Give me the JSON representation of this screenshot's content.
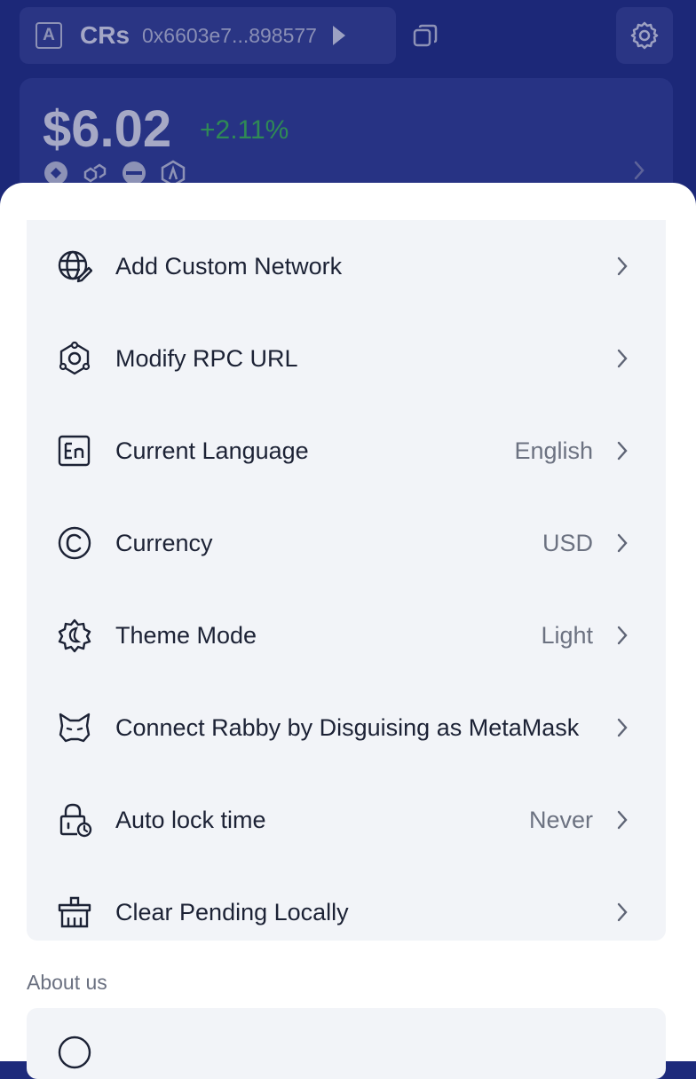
{
  "header": {
    "account_badge": "A",
    "account_name": "CRs",
    "account_address": "0x6603e7...898577",
    "balance": "$6.02",
    "balance_change": "+2.11%",
    "change_color": "#2f8a55",
    "chain_icons": [
      "chain-icon-1",
      "chain-icon-2",
      "chain-icon-3",
      "chain-icon-4"
    ]
  },
  "settings": {
    "items": [
      {
        "label": "Add Custom Network",
        "value": "",
        "icon": "globe-edit-icon"
      },
      {
        "label": "Modify RPC URL",
        "value": "",
        "icon": "rpc-node-icon"
      },
      {
        "label": "Current Language",
        "value": "English",
        "icon": "language-en-icon"
      },
      {
        "label": "Currency",
        "value": "USD",
        "icon": "currency-icon"
      },
      {
        "label": "Theme Mode",
        "value": "Light",
        "icon": "theme-icon"
      },
      {
        "label": "Connect Rabby by Disguising as MetaMask",
        "value": "",
        "icon": "fox-mask-icon"
      },
      {
        "label": "Auto lock time",
        "value": "Never",
        "icon": "lock-clock-icon"
      },
      {
        "label": "Clear Pending Locally",
        "value": "",
        "icon": "broom-icon"
      }
    ]
  },
  "about": {
    "title": "About us"
  }
}
